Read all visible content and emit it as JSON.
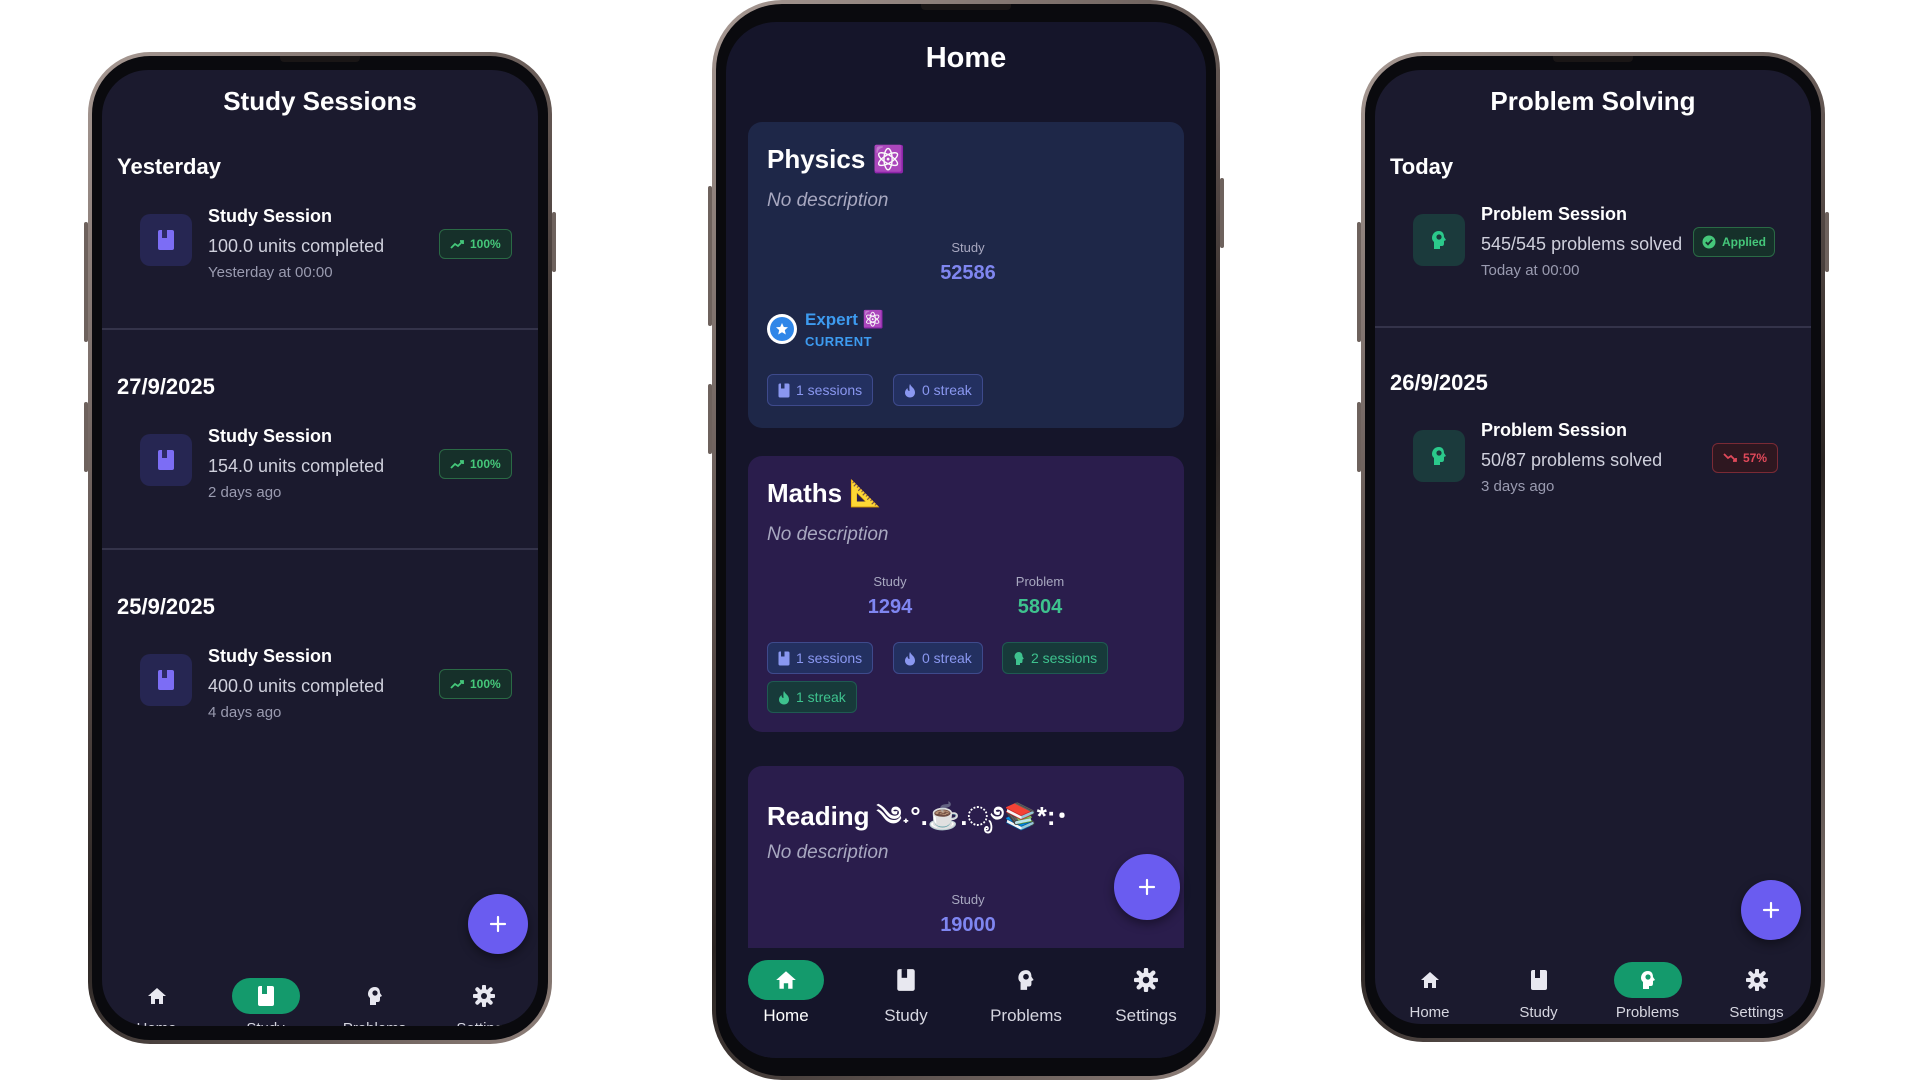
{
  "study_screen": {
    "title": "Study Sessions",
    "sections": [
      {
        "heading": "Yesterday",
        "item": {
          "title": "Study Session",
          "subtitle": "100.0 units completed",
          "time": "Yesterday at 00:00",
          "badge": "100%"
        }
      },
      {
        "heading": "27/9/2025",
        "item": {
          "title": "Study Session",
          "subtitle": "154.0 units completed",
          "time": "2 days ago",
          "badge": "100%"
        }
      },
      {
        "heading": "25/9/2025",
        "item": {
          "title": "Study Session",
          "subtitle": "400.0 units completed",
          "time": "4 days ago",
          "badge": "100%"
        }
      }
    ]
  },
  "home_screen": {
    "title": "Home",
    "physics": {
      "title": "Physics ⚛️",
      "description": "No description",
      "study_label": "Study",
      "study_value": "52586",
      "level_name": "Expert ⚛️",
      "level_tag": "CURRENT",
      "pill_sessions": "1 sessions",
      "pill_streak": "0 streak"
    },
    "maths": {
      "title": "Maths 📐",
      "description": "No description",
      "study_label": "Study",
      "study_value": "1294",
      "problem_label": "Problem",
      "problem_value": "5804",
      "pill_sessions": "1 sessions",
      "pill_streak": "0 streak",
      "pill_problem_sessions": "2 sessions",
      "pill_problem_streak": "1 streak"
    },
    "reading": {
      "title": "Reading ༄˖°.☕.ೃ࿔📚*:･",
      "description": "No description",
      "study_label": "Study",
      "study_value": "19000"
    }
  },
  "problem_screen": {
    "title": "Problem Solving",
    "sections": [
      {
        "heading": "Today",
        "item": {
          "title": "Problem Session",
          "subtitle": "545/545 problems solved",
          "time": "Today at 00:00",
          "badge": "Applied"
        }
      },
      {
        "heading": "26/9/2025",
        "item": {
          "title": "Problem Session",
          "subtitle": "50/87 problems solved",
          "time": "3 days ago",
          "badge": "57%"
        }
      }
    ]
  },
  "nav": {
    "home": "Home",
    "study": "Study",
    "problems": "Problems",
    "settings": "Settings"
  },
  "colors": {
    "background": "#1b1a2e",
    "accent": "#6a5cf0",
    "active_nav": "#149a6c",
    "success": "#45c77a",
    "danger": "#e0495a"
  }
}
